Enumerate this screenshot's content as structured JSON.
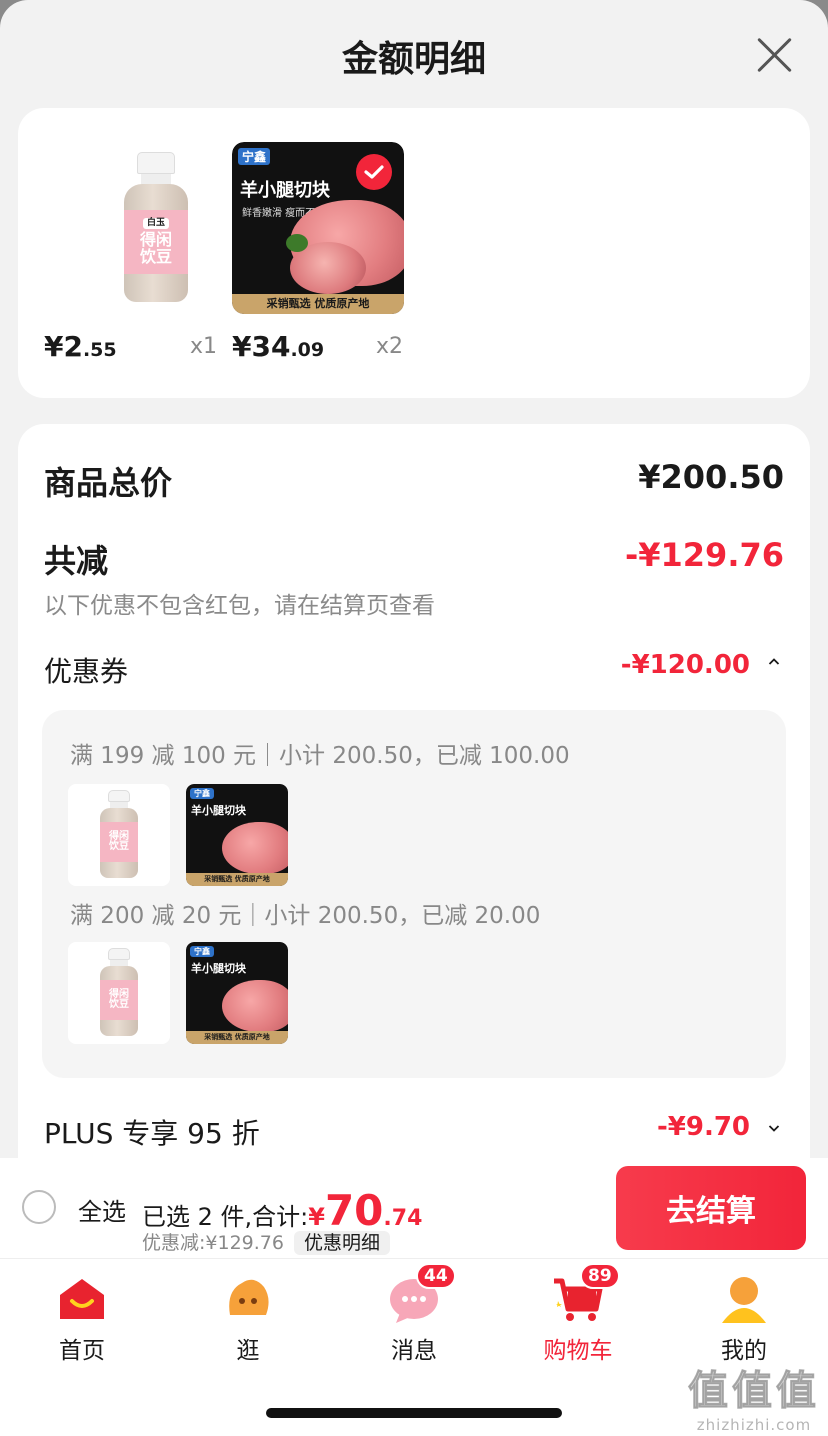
{
  "sheet": {
    "title": "金额明细"
  },
  "products": [
    {
      "name": "得闲饮豆",
      "brand_tag": "白玉",
      "price_int": "¥2",
      "price_dec": ".55",
      "qty": "x1",
      "checked": true
    },
    {
      "name": "羊小腿切块",
      "brand_tag": "宁鑫",
      "subtitle": "鲜香嫩滑 瘦而不柴",
      "banner": "采销甄选 优质原产地",
      "price_int": "¥34",
      "price_dec": ".09",
      "qty": "x2",
      "checked": true
    }
  ],
  "detail": {
    "total_label": "商品总价",
    "total_value": "¥200.50",
    "reduce_label": "共减",
    "reduce_value": "-¥129.76",
    "reduce_hint": "以下优惠不包含红包，请在结算页查看",
    "coupon_label": "优惠券",
    "coupon_value": "-¥120.00",
    "coupons": [
      {
        "text": "满 199 减 100 元｜小计 200.50，已减 100.00"
      },
      {
        "text": "满 200 减 20 元｜小计 200.50，已减 20.00"
      }
    ],
    "plus_label": "PLUS 专享 95 折",
    "plus_value": "-¥9.70"
  },
  "checkout": {
    "select_all": "全选",
    "summary_prefix": "已选 2 件,合计:",
    "amount_symbol": "¥",
    "amount_int": "70",
    "amount_dec": ".74",
    "discount_text": "优惠减:¥129.76",
    "detail_chip": "优惠明细",
    "button": "去结算"
  },
  "tabs": [
    {
      "label": "首页",
      "icon": "home-icon",
      "active": false
    },
    {
      "label": "逛",
      "icon": "browse-icon",
      "active": false
    },
    {
      "label": "消息",
      "icon": "message-icon",
      "badge": "44",
      "active": false
    },
    {
      "label": "购物车",
      "icon": "cart-icon",
      "badge": "89",
      "active": true
    },
    {
      "label": "我的",
      "icon": "profile-icon",
      "active": false
    }
  ],
  "watermark": {
    "big": "值值值",
    "small": "zhizhizhi.com"
  },
  "colors": {
    "accent": "#f2253a",
    "background": "#f2f2f2"
  }
}
